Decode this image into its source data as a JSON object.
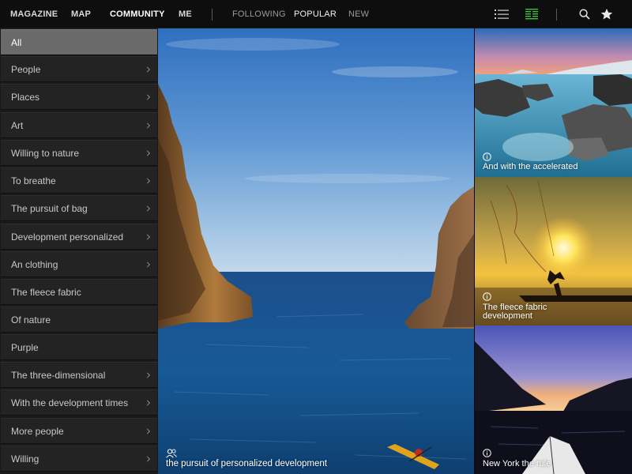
{
  "nav": {
    "primary": [
      "MAGAZINE",
      "MAP",
      "COMMUNITY",
      "ME"
    ],
    "active_primary": "COMMUNITY",
    "secondary": [
      "FOLLOWING",
      "POPULAR",
      "NEW"
    ],
    "active_secondary": "POPULAR",
    "icons": [
      "list-view-icon",
      "grid-view-icon",
      "search-icon",
      "star-icon"
    ],
    "accent_color": "#3fbf3f"
  },
  "sidebar": {
    "items": [
      {
        "label": "All",
        "has_arrow": false,
        "active": true
      },
      {
        "label": "People",
        "has_arrow": true
      },
      {
        "label": "Places",
        "has_arrow": true
      },
      {
        "label": "Art",
        "has_arrow": true
      },
      {
        "label": "Willing to nature",
        "has_arrow": true
      },
      {
        "label": "To breathe",
        "has_arrow": true
      },
      {
        "label": "The pursuit of bag",
        "has_arrow": true
      },
      {
        "label": "Development personalized",
        "has_arrow": true
      },
      {
        "label": "An clothing",
        "has_arrow": true
      },
      {
        "label": "The fleece fabric",
        "has_arrow": false
      },
      {
        "label": "Of nature",
        "has_arrow": false
      },
      {
        "label": "Purple",
        "has_arrow": false
      },
      {
        "label": "The three-dimensional",
        "has_arrow": true
      },
      {
        "label": "With the development times",
        "has_arrow": true
      },
      {
        "label": "More people",
        "has_arrow": true
      },
      {
        "label": "Willing",
        "has_arrow": true
      }
    ]
  },
  "main": {
    "caption": "the pursuit of personalized development",
    "caption_icon": "people-icon"
  },
  "tiles": [
    {
      "caption_lines": [
        "And with the accelerated"
      ],
      "icon": "info-icon"
    },
    {
      "caption_lines": [
        "The fleece fabric",
        "development"
      ],
      "icon": "info-icon"
    },
    {
      "caption_lines": [
        "New York the rule"
      ],
      "icon": "info-icon"
    }
  ]
}
